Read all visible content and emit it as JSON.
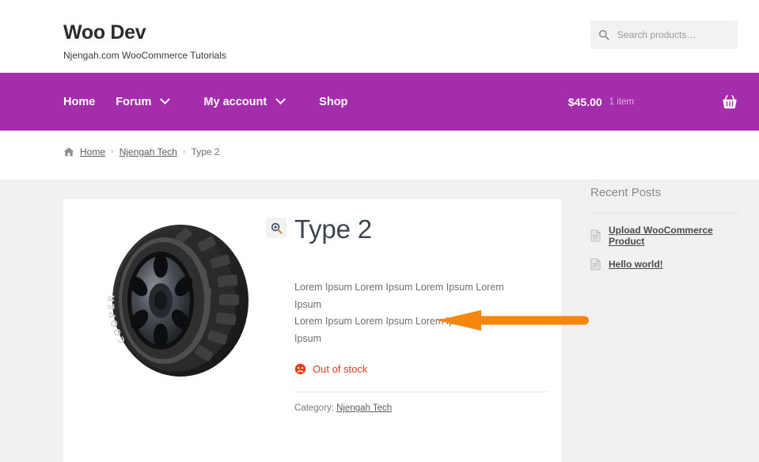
{
  "header": {
    "brand_title": "Woo Dev",
    "brand_tagline": "Njengah.com WooCommerce Tutorials",
    "search": {
      "placeholder": "Search products…",
      "value": "",
      "icon": "search-icon"
    }
  },
  "nav": {
    "background_color": "#a32daa",
    "items": [
      {
        "label": "Home",
        "has_dropdown": false
      },
      {
        "label": "Forum",
        "has_dropdown": true
      },
      {
        "label": "My account",
        "has_dropdown": true
      },
      {
        "label": "Shop",
        "has_dropdown": false
      }
    ],
    "cart": {
      "total": "$45.00",
      "count": "1 item",
      "icon": "shopping-basket-icon"
    }
  },
  "breadcrumb": {
    "home_icon": "home-icon",
    "items": [
      {
        "label": "Home",
        "link": true
      },
      {
        "label": "Njengah Tech",
        "link": true
      },
      {
        "label": "Type 2",
        "link": false
      }
    ],
    "separator": "›"
  },
  "product": {
    "title": "Type 2",
    "description_line1": "Lorem Ipsum  Lorem Ipsum Lorem Ipsum Lorem Ipsum",
    "description_line2": "Lorem Ipsum Lorem Ipsum Lorem Ipsum Lorem Ipsum",
    "stock_status": "Out of stock",
    "stock_status_color": "#e2401c",
    "stock_icon": "sad-face-icon",
    "category_label": "Category:",
    "category_value": "Njengah Tech",
    "gallery": {
      "image_alt": "Cooper Discoverer STT Pro tire",
      "zoom_icon": "magnifier-plus-icon"
    }
  },
  "sidebar": {
    "widget_title": "Recent Posts",
    "posts": [
      {
        "label": "Upload WooCommerce Product",
        "icon": "document-icon"
      },
      {
        "label": "Hello world!",
        "icon": "document-icon"
      }
    ]
  },
  "annotation": {
    "type": "arrow-left",
    "color": "#f7860f"
  }
}
